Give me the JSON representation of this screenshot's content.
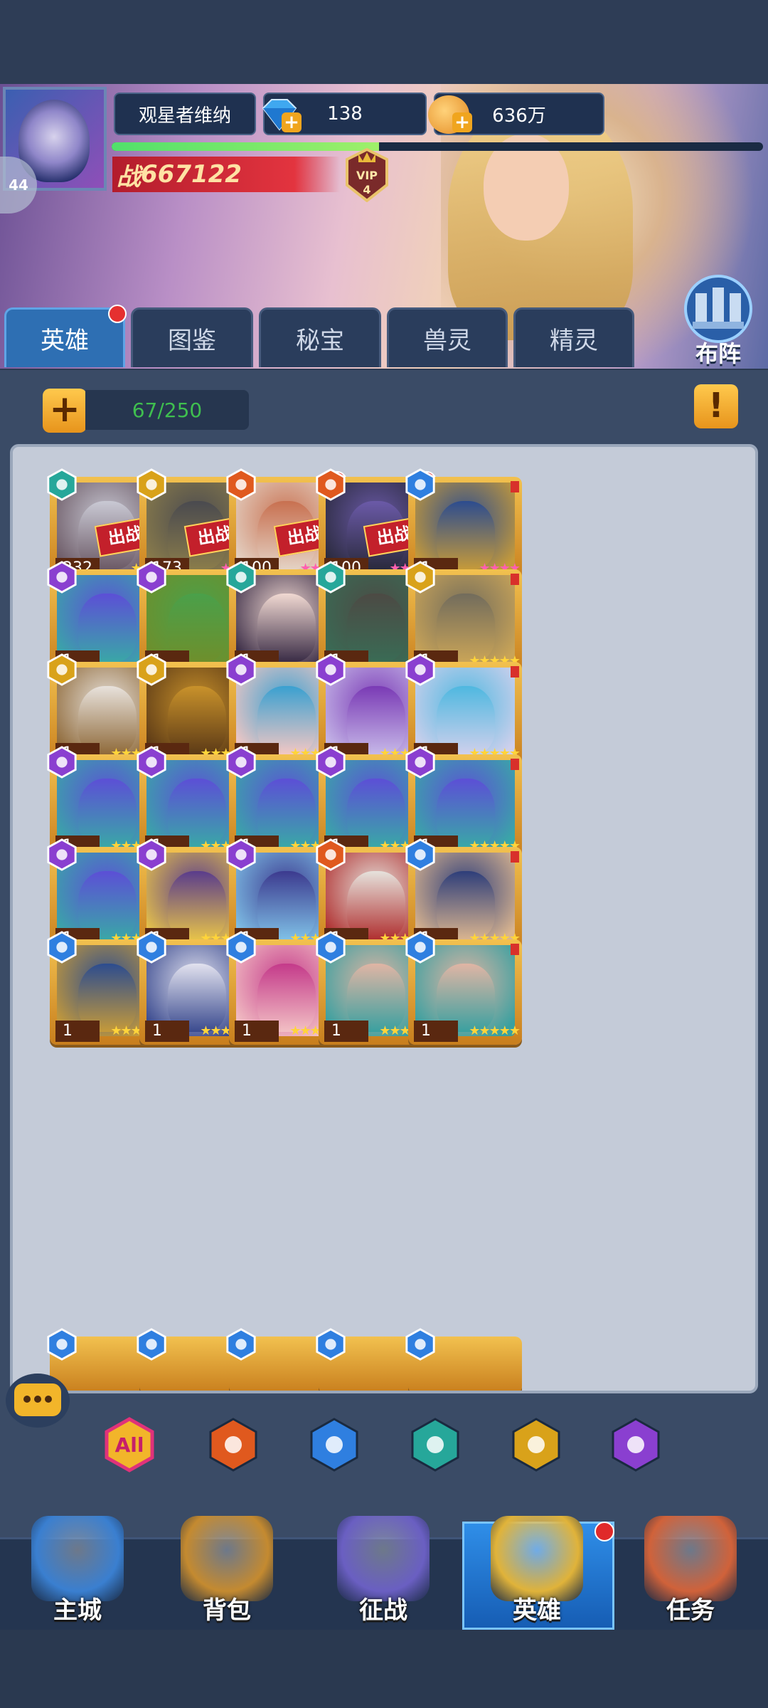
{
  "player": {
    "name": "观星者维纳",
    "level": "44",
    "gems": "138",
    "gold": "636万",
    "power_prefix": "战",
    "power": "667122",
    "vip_label": "VIP",
    "vip_level": "4",
    "exp_progress": 0.41
  },
  "tabs": [
    {
      "label": "英雄",
      "active": true
    },
    {
      "label": "图鉴"
    },
    {
      "label": "秘宝"
    },
    {
      "label": "兽灵"
    },
    {
      "label": "精灵"
    }
  ],
  "formation_label": "布阵",
  "hero_count": "67/250",
  "add_symbol": "+",
  "info_symbol": "!",
  "deploy_label": "出战",
  "factions": {
    "skull": "#26a79a",
    "gold": "#d9a21a",
    "fire": "#e0591e",
    "blue": "#2f7fe0",
    "purple": "#8a3fd0"
  },
  "heroes": [
    {
      "level": "232",
      "stars": 3,
      "star_color": "yellow",
      "faction": "skull",
      "deployed": true,
      "dot": false,
      "palette": [
        "#c9c9d4",
        "#6c5a66"
      ]
    },
    {
      "level": "173",
      "stars": 3,
      "star_color": "pink",
      "faction": "gold",
      "deployed": true,
      "dot": false,
      "palette": [
        "#4a4a4f",
        "#8a7c4b"
      ]
    },
    {
      "level": "100",
      "stars": 4,
      "star_color": "pink",
      "faction": "fire",
      "deployed": true,
      "dot": true,
      "palette": [
        "#c87050",
        "#e4d2c4"
      ]
    },
    {
      "level": "100",
      "stars": 4,
      "star_color": "pink",
      "faction": "fire",
      "deployed": true,
      "dot": true,
      "palette": [
        "#6b5aa8",
        "#2a2a3d"
      ]
    },
    {
      "level": "1",
      "stars": 4,
      "star_color": "pink",
      "faction": "blue",
      "deployed": false,
      "dot": false,
      "palette": [
        "#2c4c8f",
        "#c59a3a"
      ]
    },
    {
      "level": "1",
      "stars": 1,
      "star_color": "pink",
      "faction": "purple",
      "deployed": false,
      "dot": false,
      "palette": [
        "#5c4fd6",
        "#3aa7a7"
      ]
    },
    {
      "level": "1",
      "stars": 1,
      "star_color": "pink",
      "faction": "purple",
      "deployed": false,
      "dot": false,
      "palette": [
        "#4aa04a",
        "#6e8f2c"
      ]
    },
    {
      "level": "1",
      "stars": 1,
      "star_color": "pink",
      "faction": "skull",
      "deployed": false,
      "dot": false,
      "palette": [
        "#f1d9d2",
        "#3a2c46"
      ]
    },
    {
      "level": "1",
      "stars": 1,
      "star_color": "pink",
      "faction": "skull",
      "deployed": false,
      "dot": false,
      "palette": [
        "#4c4a44",
        "#3a6b55"
      ]
    },
    {
      "level": "1",
      "stars": 5,
      "star_color": "yellow",
      "faction": "gold",
      "deployed": false,
      "dot": false,
      "palette": [
        "#726c5c",
        "#c9a458"
      ]
    },
    {
      "level": "1",
      "stars": 5,
      "star_color": "yellow",
      "faction": "gold",
      "deployed": false,
      "dot": false,
      "palette": [
        "#e8e2dc",
        "#8f6a3a"
      ]
    },
    {
      "level": "1",
      "stars": 5,
      "star_color": "yellow",
      "faction": "gold",
      "deployed": false,
      "dot": false,
      "palette": [
        "#c9922b",
        "#5c3a16"
      ]
    },
    {
      "level": "1",
      "stars": 5,
      "star_color": "yellow",
      "faction": "purple",
      "deployed": false,
      "dot": false,
      "palette": [
        "#3aa0d0",
        "#f2c7c4"
      ]
    },
    {
      "level": "1",
      "stars": 5,
      "star_color": "yellow",
      "faction": "purple",
      "deployed": false,
      "dot": false,
      "palette": [
        "#7a3ab5",
        "#c6b8e8"
      ]
    },
    {
      "level": "1",
      "stars": 5,
      "star_color": "yellow",
      "faction": "purple",
      "deployed": false,
      "dot": false,
      "palette": [
        "#4fb8e0",
        "#cfd0ec"
      ]
    },
    {
      "level": "1",
      "stars": 5,
      "star_color": "yellow",
      "faction": "purple",
      "deployed": false,
      "dot": false,
      "palette": [
        "#5c4fd6",
        "#3aa7a7"
      ]
    },
    {
      "level": "1",
      "stars": 5,
      "star_color": "yellow",
      "faction": "purple",
      "deployed": false,
      "dot": false,
      "palette": [
        "#5c4fd6",
        "#3aa7a7"
      ]
    },
    {
      "level": "1",
      "stars": 5,
      "star_color": "yellow",
      "faction": "purple",
      "deployed": false,
      "dot": false,
      "palette": [
        "#5c4fd6",
        "#3aa7a7"
      ]
    },
    {
      "level": "1",
      "stars": 5,
      "star_color": "yellow",
      "faction": "purple",
      "deployed": false,
      "dot": false,
      "palette": [
        "#5c4fd6",
        "#3aa7a7"
      ]
    },
    {
      "level": "1",
      "stars": 5,
      "star_color": "yellow",
      "faction": "purple",
      "deployed": false,
      "dot": false,
      "palette": [
        "#5c4fd6",
        "#3aa7a7"
      ]
    },
    {
      "level": "1",
      "stars": 5,
      "star_color": "yellow",
      "faction": "purple",
      "deployed": false,
      "dot": false,
      "palette": [
        "#5c4fd6",
        "#3aa7a7"
      ]
    },
    {
      "level": "1",
      "stars": 5,
      "star_color": "yellow",
      "faction": "purple",
      "deployed": false,
      "dot": false,
      "palette": [
        "#5a3c8c",
        "#e6c24a"
      ]
    },
    {
      "level": "1",
      "stars": 5,
      "star_color": "yellow",
      "faction": "purple",
      "deployed": false,
      "dot": false,
      "palette": [
        "#3c3a8f",
        "#7fc0e6"
      ]
    },
    {
      "level": "1",
      "stars": 5,
      "star_color": "yellow",
      "faction": "fire",
      "deployed": false,
      "dot": false,
      "palette": [
        "#e6e2dc",
        "#b03030"
      ]
    },
    {
      "level": "1",
      "stars": 5,
      "star_color": "yellow",
      "faction": "blue",
      "deployed": false,
      "dot": false,
      "palette": [
        "#2e3e7a",
        "#d9b48f"
      ]
    },
    {
      "level": "1",
      "stars": 5,
      "star_color": "yellow",
      "faction": "blue",
      "deployed": false,
      "dot": false,
      "palette": [
        "#2c4c8f",
        "#c59a3a"
      ]
    },
    {
      "level": "1",
      "stars": 5,
      "star_color": "yellow",
      "faction": "blue",
      "deployed": false,
      "dot": false,
      "palette": [
        "#e2e2ef",
        "#3a4a8f"
      ]
    },
    {
      "level": "1",
      "stars": 5,
      "star_color": "yellow",
      "faction": "blue",
      "deployed": false,
      "dot": false,
      "palette": [
        "#c43a8a",
        "#f2c0c4"
      ]
    },
    {
      "level": "1",
      "stars": 5,
      "star_color": "yellow",
      "faction": "blue",
      "deployed": false,
      "dot": false,
      "palette": [
        "#e0b5a4",
        "#3aa0a0"
      ]
    },
    {
      "level": "1",
      "stars": 5,
      "star_color": "yellow",
      "faction": "blue",
      "deployed": false,
      "dot": false,
      "palette": [
        "#e0b5a4",
        "#3aa0a0"
      ]
    }
  ],
  "partial_row_factions": [
    "blue",
    "blue",
    "blue",
    "blue",
    "blue"
  ],
  "filters": [
    {
      "label": "All",
      "name": "filter-all-button"
    },
    {
      "label": "",
      "name": "filter-fire-button",
      "faction": "fire"
    },
    {
      "label": "",
      "name": "filter-blue-button",
      "faction": "blue"
    },
    {
      "label": "",
      "name": "filter-skull-button",
      "faction": "skull"
    },
    {
      "label": "",
      "name": "filter-gold-button",
      "faction": "gold"
    },
    {
      "label": "",
      "name": "filter-purple-button",
      "faction": "purple"
    }
  ],
  "nav": [
    {
      "label": "主城",
      "name": "nav-main-city",
      "icon": "castle-icon",
      "color": "#3a7fd0"
    },
    {
      "label": "背包",
      "name": "nav-backpack",
      "icon": "treasure-chest-icon",
      "color": "#c48a30"
    },
    {
      "label": "征战",
      "name": "nav-campaign",
      "icon": "dragon-portal-icon",
      "color": "#6a5fc2"
    },
    {
      "label": "英雄",
      "name": "nav-heroes",
      "icon": "hero-helmet-icon",
      "color": "#e0b33a"
    },
    {
      "label": "任务",
      "name": "nav-quests",
      "icon": "scroll-icon",
      "color": "#d0623a"
    }
  ]
}
